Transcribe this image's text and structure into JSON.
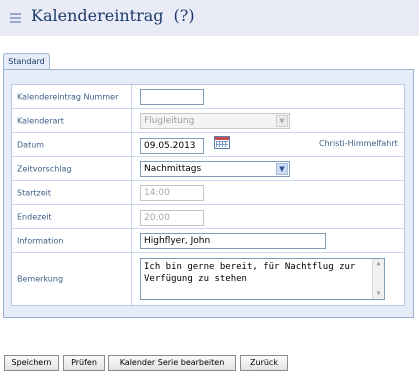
{
  "header": {
    "title": "Kalendereintrag",
    "help": "(?)"
  },
  "tabs": [
    {
      "label": "Standard"
    }
  ],
  "form": {
    "nummer": {
      "label": "Kalendereintrag Nummer",
      "value": ""
    },
    "kalenderart": {
      "label": "Kalenderart",
      "value": "Flugleitung"
    },
    "datum": {
      "label": "Datum",
      "value": "09.05.2013",
      "holiday": "Christi-Himmelfahrt"
    },
    "zeitvorschlag": {
      "label": "Zeitvorschlag",
      "value": "Nachmittags"
    },
    "startzeit": {
      "label": "Startzeit",
      "value": "14:00"
    },
    "endezeit": {
      "label": "Endezeit",
      "value": "20:00"
    },
    "information": {
      "label": "Information",
      "value": "Highflyer, John"
    },
    "bemerkung": {
      "label": "Bemerkung",
      "value": "Ich bin gerne bereit, für Nachtflug zur Verfügung zu stehen"
    }
  },
  "buttons": {
    "speichern": "Speichern",
    "pruefen": "Prüfen",
    "serie": "Kalender Serie bearbeiten",
    "zurueck": "Zurück"
  },
  "icons": {
    "menu": "menu-icon",
    "calendar": "calendar-icon"
  },
  "colors": {
    "header_bg": "#e9ecf7",
    "title": "#1d3a68",
    "label": "#3b5d86",
    "panel_bg": "#e6ecf8"
  }
}
